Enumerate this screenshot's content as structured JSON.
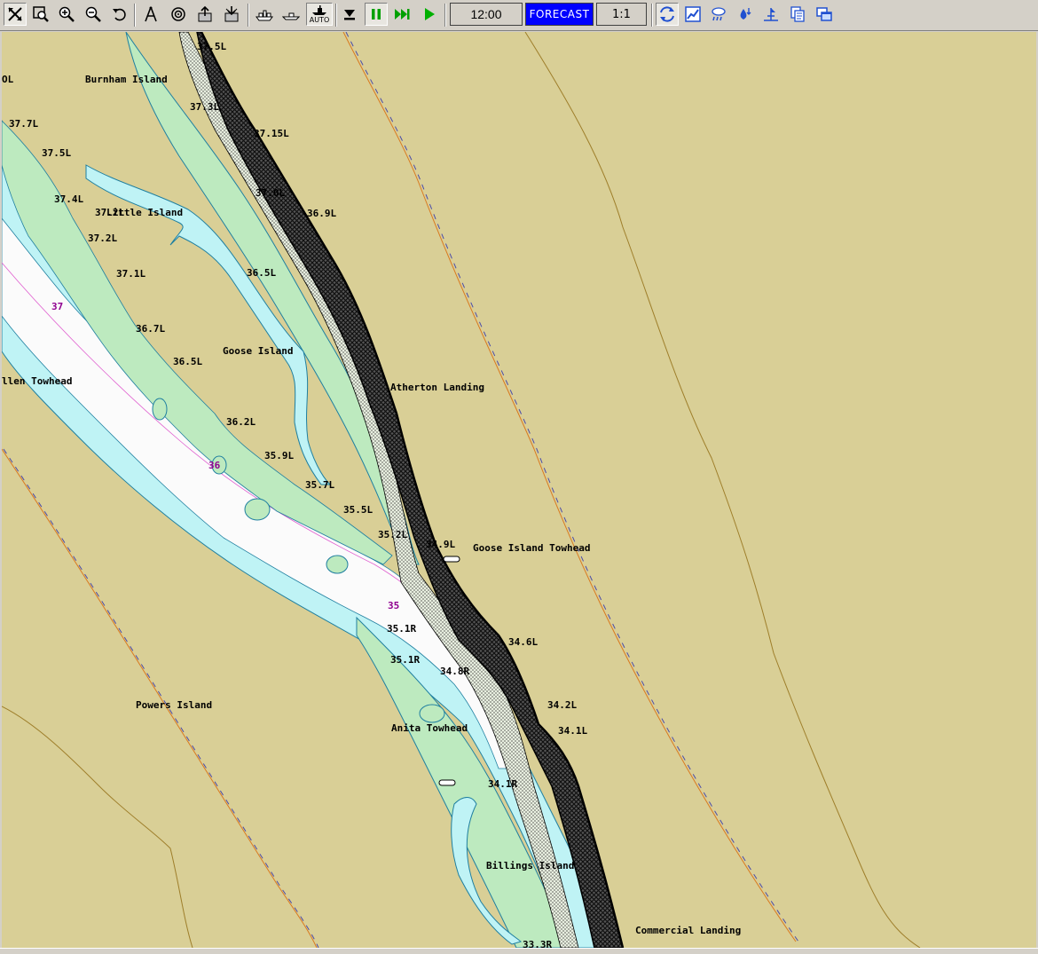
{
  "toolbar": {
    "buttons": [
      {
        "name": "select-tool-icon"
      },
      {
        "name": "zoom-window-icon"
      },
      {
        "name": "zoom-in-icon"
      },
      {
        "name": "zoom-out-icon"
      },
      {
        "name": "undo-view-icon"
      },
      {
        "name": "measure-tool-icon"
      },
      {
        "name": "target-icon"
      },
      {
        "name": "load-icon"
      },
      {
        "name": "save-icon"
      },
      {
        "name": "vessel-icon"
      },
      {
        "name": "boat-icon"
      },
      {
        "name": "auto-vessel-icon"
      },
      {
        "name": "step-to-end-icon"
      },
      {
        "name": "pause-icon"
      },
      {
        "name": "fast-forward-icon"
      },
      {
        "name": "play-icon"
      },
      {
        "name": "sync-icon"
      },
      {
        "name": "chart-graph-icon"
      },
      {
        "name": "weather-icon"
      },
      {
        "name": "water-level-icon"
      },
      {
        "name": "navigation-icon"
      },
      {
        "name": "copy-pages-icon"
      },
      {
        "name": "windows-icon"
      }
    ],
    "auto_label": "AUTO",
    "time": "12:00",
    "forecast_label": "FORECAST",
    "scale": "1:1"
  },
  "map": {
    "colors": {
      "land": "#d9cf96",
      "shallow": "#bdeabf",
      "water": "#bff3f5",
      "deep": "#fbfbfb",
      "contour": "#9e7e2a",
      "orange_line": "#d97a20",
      "blue_line": "#4a4aa8",
      "sailing_line": "#e060d0"
    },
    "place_names": [
      "Burnham Island",
      "Little Island",
      "Goose Island",
      "Atherton Landing",
      "Goose Island Towhead",
      "llen Towhead",
      "Powers Island",
      "Anita Towhead",
      "Billings Island",
      "Commercial Landing",
      "OL"
    ],
    "mile_markers": [
      "37.5L",
      "37.3L",
      "37.15L",
      "37.0L",
      "36.9L",
      "37.7L",
      "37.5L",
      "37.4L",
      "37.2L",
      "37.2L",
      "37.1L",
      "36.5L",
      "36.7L",
      "36.5L",
      "36.2L",
      "35.9L",
      "35.7L",
      "35.5L",
      "35.2L",
      "34.9L",
      "34.6L",
      "35.1R",
      "35.1R",
      "34.8R",
      "34.2L",
      "34.1L",
      "34.1R",
      "33.3R"
    ],
    "depth_labels": [
      "37",
      "36",
      "35"
    ]
  }
}
